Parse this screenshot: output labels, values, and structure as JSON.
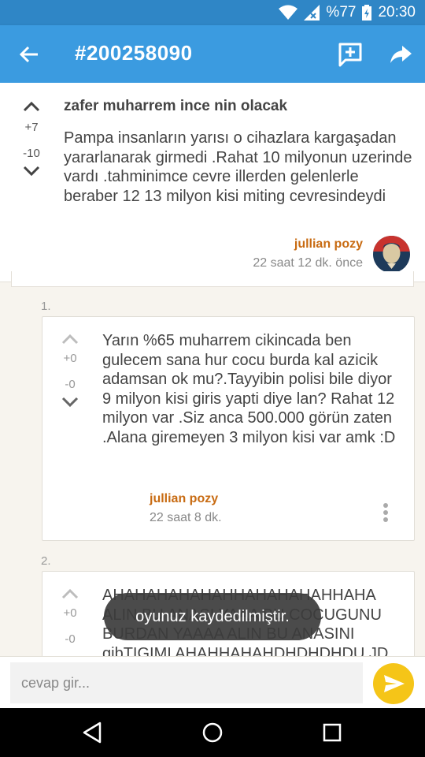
{
  "status_bar": {
    "battery_text": "%77",
    "time": "20:30",
    "icons": [
      "wifi-icon",
      "signal-icon",
      "battery-icon"
    ]
  },
  "app_bar": {
    "title": "#200258090",
    "icons": [
      "back-arrow-icon",
      "add-comment-icon",
      "share-icon"
    ]
  },
  "post": {
    "title": "zafer muharrem ince nin olacak",
    "body": "Pampa insanların yarısı o cihazlara kargaşadan yararlanarak girmedi .Rahat 10 milyonun uzerinde vardı .tahminimce cevre illerden gelenlerle beraber 12 13 milyon kisi miting cevresindeydi",
    "votes_up": "+7",
    "votes_down": "-10",
    "author": "jullian pozy",
    "time": "22 saat 12 dk. önce"
  },
  "comments": [
    {
      "index": "1.",
      "votes_up": "+0",
      "votes_down": "-0",
      "body": "Yarın %65 muharrem cikincada ben gulecem sana hur cocu burda kal azicik adamsan ok mu?.Tayyibin polisi bile diyor 9 milyon kisi giris yapti diye lan? Rahat 12 milyon var .Siz anca 500.000 görün zaten .Alana giremeyen 3 milyon kisi var amk :D",
      "author": "jullian pozy",
      "time": "22 saat 8 dk."
    },
    {
      "index": "2.",
      "votes_up": "+0",
      "votes_down": "-0",
      "body": "AHAHAHAHAHAHHAHAHAHAHHAHA ALIN BU ANASI YAAA BU COCUGUNU BURDAN YAAAA ALIN BU ANASINI gibTIGIMI AHAHHAHAHDHDHDHDU JD"
    }
  ],
  "toast": "oyunuz kaydedilmiştir.",
  "composer": {
    "placeholder": "cevap gir..."
  },
  "colors": {
    "status_bar": "#2f86c6",
    "app_bar": "#3b9be0",
    "author": "#c86b12",
    "send_button": "#f5c518",
    "background": "#f7f4ee"
  }
}
